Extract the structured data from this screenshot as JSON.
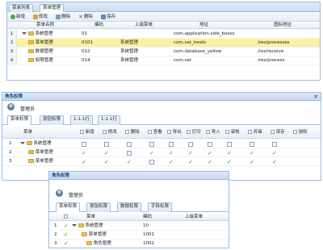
{
  "top": {
    "tabs": [
      {
        "label": "菜单列表"
      },
      {
        "label": "菜单管理"
      }
    ],
    "toolbar": {
      "add": "新增",
      "edit": "修改",
      "delete": "删除",
      "remove": "删除",
      "save": "保存"
    },
    "columns": [
      "菜单名称",
      "编码",
      "上级菜单",
      "地址",
      "图标地址"
    ],
    "rows": [
      {
        "num": "1",
        "name": "系统管理",
        "code": "01",
        "parent": "",
        "url": "com.application.side_boxes",
        "icon": ""
      },
      {
        "num": "2",
        "name": "菜单管理",
        "code": "0101",
        "parent": "系统管理",
        "url": "com.sat_treels",
        "icon": "/res/processes"
      },
      {
        "num": "3",
        "name": "数据管理",
        "code": "012",
        "parent": "系统管理",
        "url": "com.database_yellow",
        "icon": "/res/receive"
      },
      {
        "num": "4",
        "name": "权限管理",
        "code": "014",
        "parent": "系统管理",
        "url": "com.sat",
        "icon": "/res/process"
      }
    ]
  },
  "middle": {
    "title": "角色权限",
    "role_label": "管理员",
    "tabs": [
      {
        "label": "菜单权限"
      },
      {
        "label": "按钮权限"
      },
      {
        "label": "1-1-1行"
      },
      {
        "label": "1-1-1行"
      }
    ],
    "columns": [
      "菜单",
      "新增",
      "修改",
      "删除",
      "查看",
      "导出",
      "打印",
      "导入",
      "审核",
      "弃审",
      "保存",
      "授权"
    ],
    "rows": [
      {
        "num": "1",
        "name": "系统管理",
        "checks": [
          false,
          false,
          false,
          false,
          false,
          false,
          false,
          false,
          false,
          false
        ]
      },
      {
        "num": "2",
        "name": "菜单管理",
        "checks": [
          true,
          true,
          false,
          true,
          true,
          true,
          true,
          true,
          true,
          true
        ]
      },
      {
        "num": "3",
        "name": "菜单管理",
        "checks": [
          true,
          true,
          true,
          false,
          true,
          true,
          true,
          true,
          true,
          true
        ]
      }
    ]
  },
  "bottom": {
    "title": "角色权限",
    "role_label": "管理员",
    "tabs": [
      {
        "label": "菜单权限"
      },
      {
        "label": "按钮权限"
      },
      {
        "label": "数据权限"
      },
      {
        "label": "字段权限"
      }
    ],
    "columns": [
      "",
      "菜单",
      "编码",
      "上级菜单"
    ],
    "rows": [
      {
        "num": "1",
        "name": "系统管理",
        "code": "10"
      },
      {
        "num": "2",
        "name": "菜单管理",
        "code": "1001"
      },
      {
        "num": "3",
        "name": "角色管理",
        "code": "1002"
      }
    ]
  }
}
